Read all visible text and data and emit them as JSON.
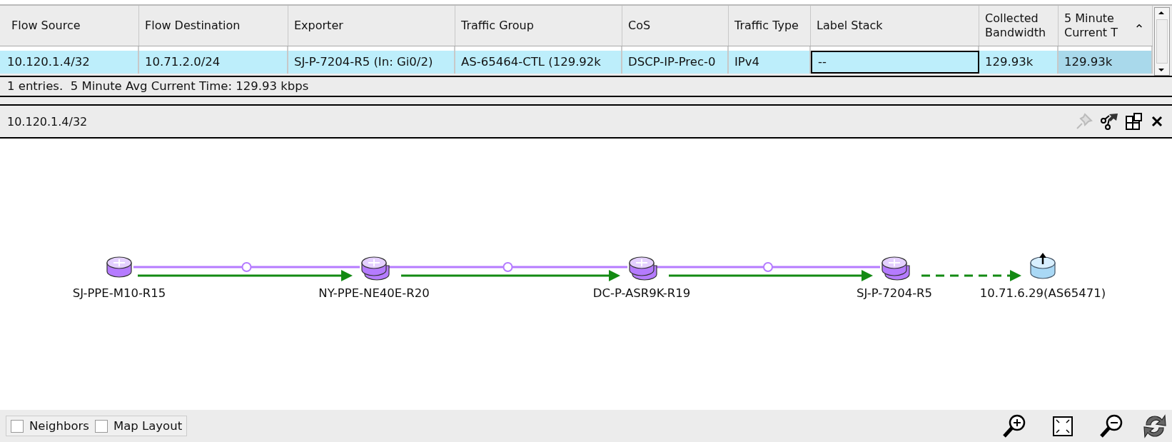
{
  "table": {
    "columns": [
      {
        "label": "Flow Source",
        "sorted": false
      },
      {
        "label": "Flow Destination",
        "sorted": false
      },
      {
        "label": "Exporter",
        "sorted": false
      },
      {
        "label": "Traffic Group",
        "sorted": false
      },
      {
        "label": "CoS",
        "sorted": false
      },
      {
        "label": "Traffic Type",
        "sorted": false
      },
      {
        "label": "Label Stack",
        "sorted": false
      },
      {
        "label": "Collected Bandwidth",
        "sorted": false
      },
      {
        "label": "5 Minute Current T",
        "sorted": true
      }
    ],
    "rows": [
      {
        "selected": true,
        "cells": [
          {
            "text": "10.120.1.4/32",
            "focused": false
          },
          {
            "text": "10.71.2.0/24",
            "focused": false
          },
          {
            "text": "SJ-P-7204-R5 (In: Gi0/2)",
            "focused": false
          },
          {
            "text": "AS-65464-CTL (129.92k",
            "focused": false
          },
          {
            "text": "DSCP-IP-Prec-0",
            "focused": false
          },
          {
            "text": "IPv4",
            "focused": false
          },
          {
            "text": "--",
            "focused": true
          },
          {
            "text": "129.93k",
            "focused": false
          },
          {
            "text": "129.93k",
            "focused": false
          }
        ]
      }
    ]
  },
  "status_bar": "1 entries.  5 Minute Avg Current Time: 129.93 kbps",
  "detail": {
    "title": "10.120.1.4/32",
    "tools": [
      {
        "kind": "pin",
        "disabled": true
      },
      {
        "kind": "export",
        "disabled": false
      },
      {
        "kind": "layout",
        "disabled": false
      },
      {
        "kind": "close",
        "disabled": false
      }
    ]
  },
  "map": {
    "nodes": [
      {
        "label": "SJ-PPE-M10-R15",
        "kind": "router"
      },
      {
        "label": "NY-PPE-NE40E-R20",
        "kind": "router-stack"
      },
      {
        "label": "DC-P-ASR9K-R19",
        "kind": "router-stack"
      },
      {
        "label": "SJ-P-7204-R5",
        "kind": "router-stack"
      },
      {
        "label": "10.71.6.29(AS65471)",
        "kind": "bgp"
      }
    ],
    "connections": [
      {
        "link": true,
        "dashed": false
      },
      {
        "link": true,
        "dashed": false
      },
      {
        "link": true,
        "dashed": false
      },
      {
        "link": false,
        "dashed": true
      }
    ]
  },
  "options": [
    {
      "label": "Neighbors",
      "checked": false
    },
    {
      "label": "Map Layout",
      "checked": false
    }
  ],
  "zoom_tools": [
    {
      "kind": "zoom-in"
    },
    {
      "kind": "fit"
    },
    {
      "kind": "zoom-out"
    },
    {
      "kind": "refresh"
    }
  ]
}
